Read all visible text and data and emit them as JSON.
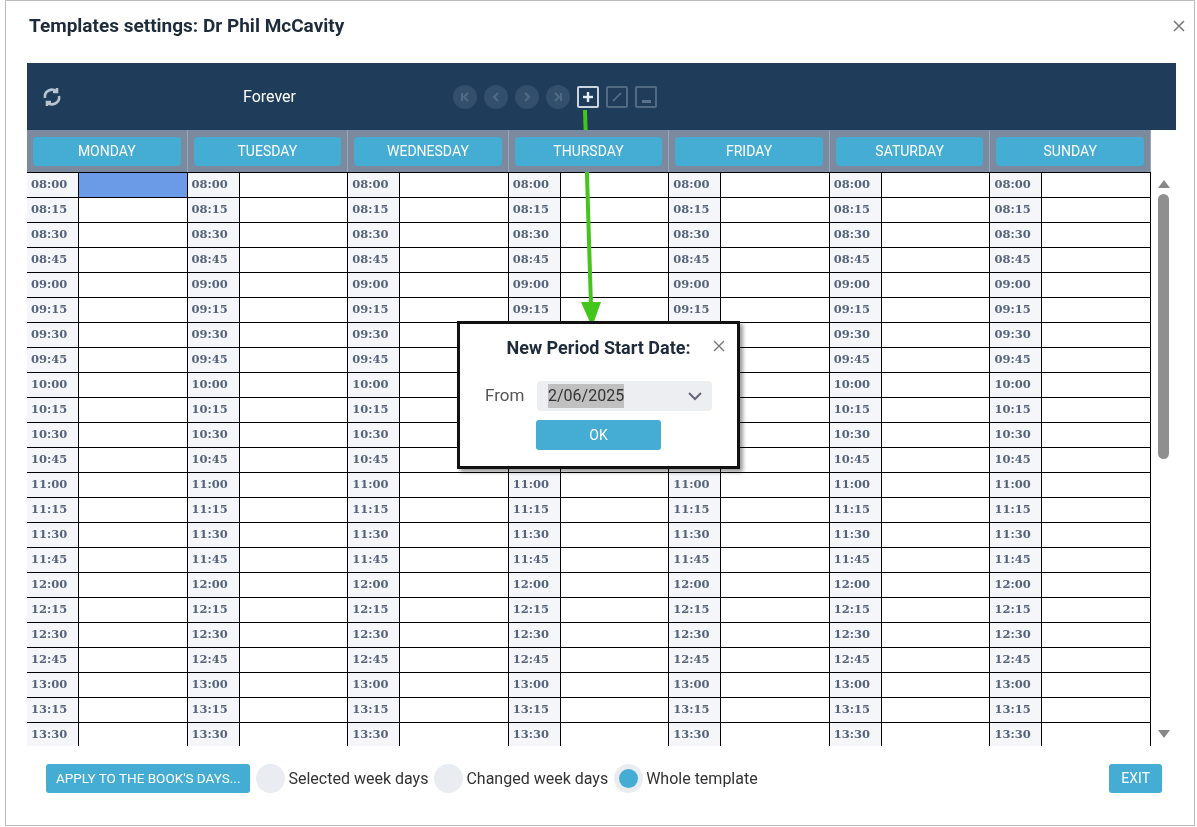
{
  "window": {
    "title": "Templates settings: Dr Phil McCavity"
  },
  "toolbar": {
    "period": "Forever",
    "buttons": [
      {
        "kind": "first",
        "disabled": true
      },
      {
        "kind": "prev",
        "disabled": true
      },
      {
        "kind": "next",
        "disabled": true
      },
      {
        "kind": "last",
        "disabled": true
      },
      {
        "kind": "add",
        "disabled": false
      },
      {
        "kind": "edit",
        "disabled": true
      },
      {
        "kind": "remove",
        "disabled": true
      }
    ]
  },
  "days": [
    {
      "label": "MONDAY",
      "slots": [
        {
          "time": "08:00",
          "selected": true
        },
        {
          "time": "08:15",
          "selected": false
        },
        {
          "time": "08:30",
          "selected": false
        },
        {
          "time": "08:45",
          "selected": false
        },
        {
          "time": "09:00",
          "selected": false
        },
        {
          "time": "09:15",
          "selected": false
        },
        {
          "time": "09:30",
          "selected": false
        },
        {
          "time": "09:45",
          "selected": false
        },
        {
          "time": "10:00",
          "selected": false
        },
        {
          "time": "10:15",
          "selected": false
        },
        {
          "time": "10:30",
          "selected": false
        },
        {
          "time": "10:45",
          "selected": false
        },
        {
          "time": "11:00",
          "selected": false
        },
        {
          "time": "11:15",
          "selected": false
        },
        {
          "time": "11:30",
          "selected": false
        },
        {
          "time": "11:45",
          "selected": false
        },
        {
          "time": "12:00",
          "selected": false
        },
        {
          "time": "12:15",
          "selected": false
        },
        {
          "time": "12:30",
          "selected": false
        },
        {
          "time": "12:45",
          "selected": false
        },
        {
          "time": "13:00",
          "selected": false
        },
        {
          "time": "13:15",
          "selected": false
        },
        {
          "time": "13:30",
          "selected": false
        }
      ]
    },
    {
      "label": "TUESDAY",
      "slots": [
        {
          "time": "08:00",
          "selected": false
        },
        {
          "time": "08:15",
          "selected": false
        },
        {
          "time": "08:30",
          "selected": false
        },
        {
          "time": "08:45",
          "selected": false
        },
        {
          "time": "09:00",
          "selected": false
        },
        {
          "time": "09:15",
          "selected": false
        },
        {
          "time": "09:30",
          "selected": false
        },
        {
          "time": "09:45",
          "selected": false
        },
        {
          "time": "10:00",
          "selected": false
        },
        {
          "time": "10:15",
          "selected": false
        },
        {
          "time": "10:30",
          "selected": false
        },
        {
          "time": "10:45",
          "selected": false
        },
        {
          "time": "11:00",
          "selected": false
        },
        {
          "time": "11:15",
          "selected": false
        },
        {
          "time": "11:30",
          "selected": false
        },
        {
          "time": "11:45",
          "selected": false
        },
        {
          "time": "12:00",
          "selected": false
        },
        {
          "time": "12:15",
          "selected": false
        },
        {
          "time": "12:30",
          "selected": false
        },
        {
          "time": "12:45",
          "selected": false
        },
        {
          "time": "13:00",
          "selected": false
        },
        {
          "time": "13:15",
          "selected": false
        },
        {
          "time": "13:30",
          "selected": false
        }
      ]
    },
    {
      "label": "WEDNESDAY",
      "slots": [
        {
          "time": "08:00",
          "selected": false
        },
        {
          "time": "08:15",
          "selected": false
        },
        {
          "time": "08:30",
          "selected": false
        },
        {
          "time": "08:45",
          "selected": false
        },
        {
          "time": "09:00",
          "selected": false
        },
        {
          "time": "09:15",
          "selected": false
        },
        {
          "time": "09:30",
          "selected": false
        },
        {
          "time": "09:45",
          "selected": false
        },
        {
          "time": "10:00",
          "selected": false
        },
        {
          "time": "10:15",
          "selected": false
        },
        {
          "time": "10:30",
          "selected": false
        },
        {
          "time": "10:45",
          "selected": false
        },
        {
          "time": "11:00",
          "selected": false
        },
        {
          "time": "11:15",
          "selected": false
        },
        {
          "time": "11:30",
          "selected": false
        },
        {
          "time": "11:45",
          "selected": false
        },
        {
          "time": "12:00",
          "selected": false
        },
        {
          "time": "12:15",
          "selected": false
        },
        {
          "time": "12:30",
          "selected": false
        },
        {
          "time": "12:45",
          "selected": false
        },
        {
          "time": "13:00",
          "selected": false
        },
        {
          "time": "13:15",
          "selected": false
        },
        {
          "time": "13:30",
          "selected": false
        }
      ]
    },
    {
      "label": "THURSDAY",
      "slots": [
        {
          "time": "08:00",
          "selected": false
        },
        {
          "time": "08:15",
          "selected": false
        },
        {
          "time": "08:30",
          "selected": false
        },
        {
          "time": "08:45",
          "selected": false
        },
        {
          "time": "09:00",
          "selected": false
        },
        {
          "time": "09:15",
          "selected": false
        }
      ],
      "slots_below_dialog": [
        {
          "time": "11:00",
          "selected": false
        },
        {
          "time": "11:15",
          "selected": false
        },
        {
          "time": "11:30",
          "selected": false
        },
        {
          "time": "11:45",
          "selected": false
        },
        {
          "time": "12:00",
          "selected": false
        },
        {
          "time": "12:15",
          "selected": false
        },
        {
          "time": "12:30",
          "selected": false
        },
        {
          "time": "12:45",
          "selected": false
        },
        {
          "time": "13:00",
          "selected": false
        },
        {
          "time": "13:15",
          "selected": false
        },
        {
          "time": "13:30",
          "selected": false
        }
      ]
    },
    {
      "label": "FRIDAY",
      "slots": [
        {
          "time": "08:00",
          "selected": false
        },
        {
          "time": "08:15",
          "selected": false
        },
        {
          "time": "08:30",
          "selected": false
        },
        {
          "time": "08:45",
          "selected": false
        },
        {
          "time": "09:00",
          "selected": false
        },
        {
          "time": "09:15",
          "selected": false
        }
      ],
      "slots_below_dialog": [
        {
          "time": "11:00",
          "selected": false
        },
        {
          "time": "11:15",
          "selected": false
        },
        {
          "time": "11:30",
          "selected": false
        },
        {
          "time": "11:45",
          "selected": false
        },
        {
          "time": "12:00",
          "selected": false
        },
        {
          "time": "12:15",
          "selected": false
        },
        {
          "time": "12:30",
          "selected": false
        },
        {
          "time": "12:45",
          "selected": false
        },
        {
          "time": "13:00",
          "selected": false
        },
        {
          "time": "13:15",
          "selected": false
        },
        {
          "time": "13:30",
          "selected": false
        }
      ]
    },
    {
      "label": "SATURDAY",
      "slots": [
        {
          "time": "08:00",
          "selected": false
        },
        {
          "time": "08:15",
          "selected": false
        },
        {
          "time": "08:30",
          "selected": false
        },
        {
          "time": "08:45",
          "selected": false
        },
        {
          "time": "09:00",
          "selected": false
        },
        {
          "time": "09:15",
          "selected": false
        },
        {
          "time": "09:30",
          "selected": false
        },
        {
          "time": "09:45",
          "selected": false
        },
        {
          "time": "10:00",
          "selected": false
        },
        {
          "time": "10:15",
          "selected": false
        },
        {
          "time": "10:30",
          "selected": false
        },
        {
          "time": "10:45",
          "selected": false
        },
        {
          "time": "11:00",
          "selected": false
        },
        {
          "time": "11:15",
          "selected": false
        },
        {
          "time": "11:30",
          "selected": false
        },
        {
          "time": "11:45",
          "selected": false
        },
        {
          "time": "12:00",
          "selected": false
        },
        {
          "time": "12:15",
          "selected": false
        },
        {
          "time": "12:30",
          "selected": false
        },
        {
          "time": "12:45",
          "selected": false
        },
        {
          "time": "13:00",
          "selected": false
        },
        {
          "time": "13:15",
          "selected": false
        },
        {
          "time": "13:30",
          "selected": false
        }
      ]
    },
    {
      "label": "SUNDAY",
      "slots": [
        {
          "time": "08:00",
          "selected": false
        },
        {
          "time": "08:15",
          "selected": false
        },
        {
          "time": "08:30",
          "selected": false
        },
        {
          "time": "08:45",
          "selected": false
        },
        {
          "time": "09:00",
          "selected": false
        },
        {
          "time": "09:15",
          "selected": false
        },
        {
          "time": "09:30",
          "selected": false
        },
        {
          "time": "09:45",
          "selected": false
        },
        {
          "time": "10:00",
          "selected": false
        },
        {
          "time": "10:15",
          "selected": false
        },
        {
          "time": "10:30",
          "selected": false
        },
        {
          "time": "10:45",
          "selected": false
        },
        {
          "time": "11:00",
          "selected": false
        },
        {
          "time": "11:15",
          "selected": false
        },
        {
          "time": "11:30",
          "selected": false
        },
        {
          "time": "11:45",
          "selected": false
        },
        {
          "time": "12:00",
          "selected": false
        },
        {
          "time": "12:15",
          "selected": false
        },
        {
          "time": "12:30",
          "selected": false
        },
        {
          "time": "12:45",
          "selected": false
        },
        {
          "time": "13:00",
          "selected": false
        },
        {
          "time": "13:15",
          "selected": false
        },
        {
          "time": "13:30",
          "selected": false
        }
      ]
    }
  ],
  "dialog": {
    "title": "New Period Start Date:",
    "field_label": "From",
    "value": "2/06/2025",
    "button": "OK"
  },
  "footer": {
    "apply_button": "APPLY TO THE BOOK'S DAYS...",
    "options": [
      {
        "label": "Selected week days",
        "selected": false
      },
      {
        "label": "Changed week days",
        "selected": false
      },
      {
        "label": "Whole template",
        "selected": true
      }
    ],
    "exit_button": "EXIT"
  }
}
